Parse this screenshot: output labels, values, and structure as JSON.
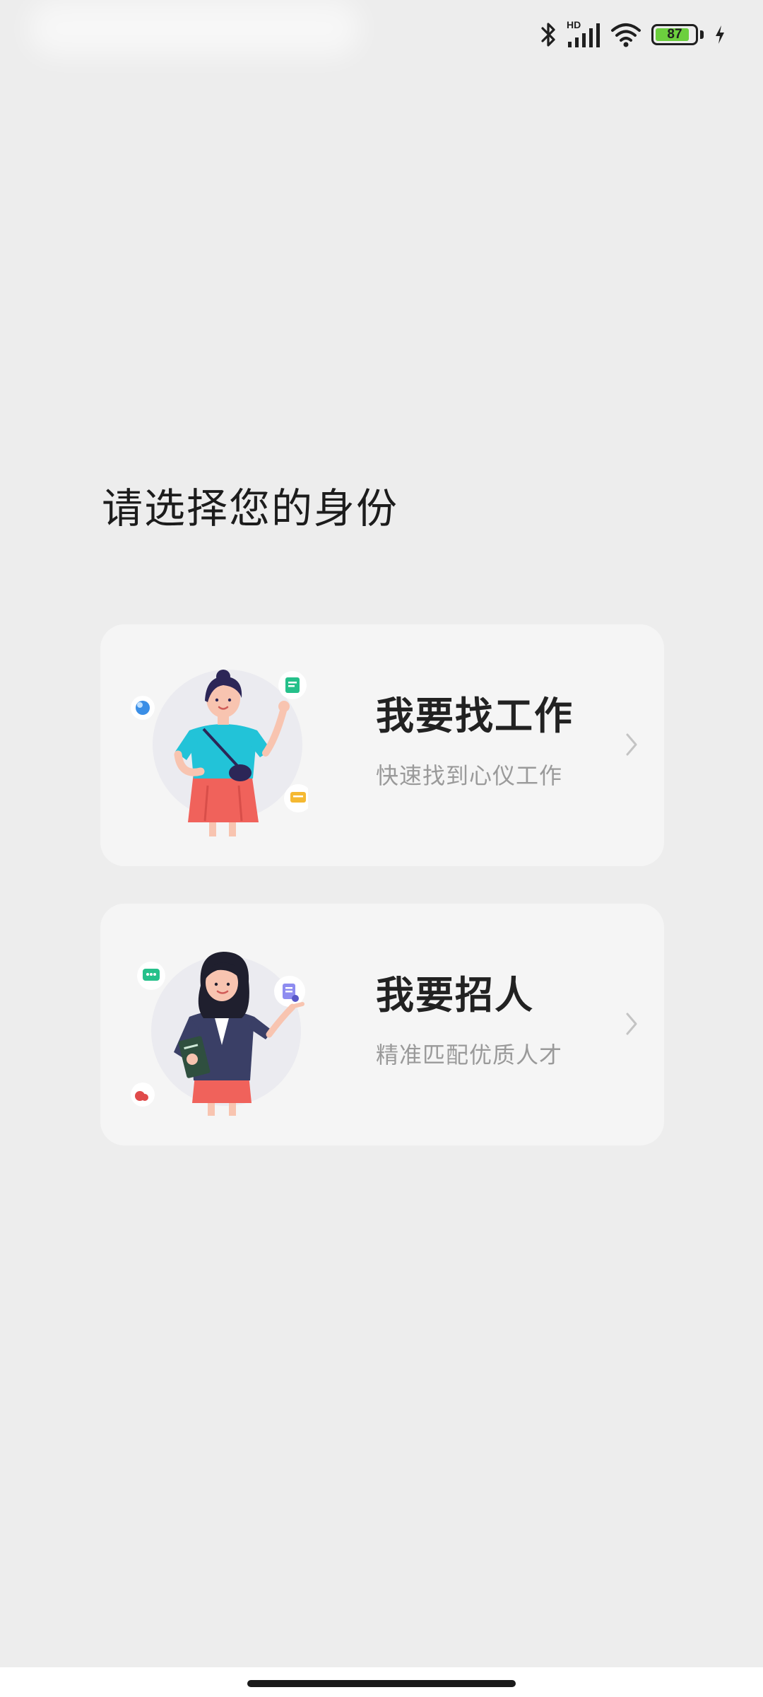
{
  "status_bar": {
    "battery_level": "87",
    "battery_fraction": 0.87,
    "network_label": "HD",
    "icons": [
      "bluetooth-icon",
      "signal-icon",
      "wifi-icon",
      "battery-icon",
      "charging-icon"
    ]
  },
  "page": {
    "title": "请选择您的身份"
  },
  "roles": [
    {
      "title": "我要找工作",
      "subtitle": "快速找到心仪工作",
      "accent": "#22c3d8"
    },
    {
      "title": "我要招人",
      "subtitle": "精准匹配优质人才",
      "accent": "#3a3f66"
    }
  ],
  "colors": {
    "background": "#ededed",
    "card": "#f5f5f5",
    "title": "#1c1c1c",
    "subtitle": "#9a9a9a",
    "battery": "#6ccf3e"
  }
}
